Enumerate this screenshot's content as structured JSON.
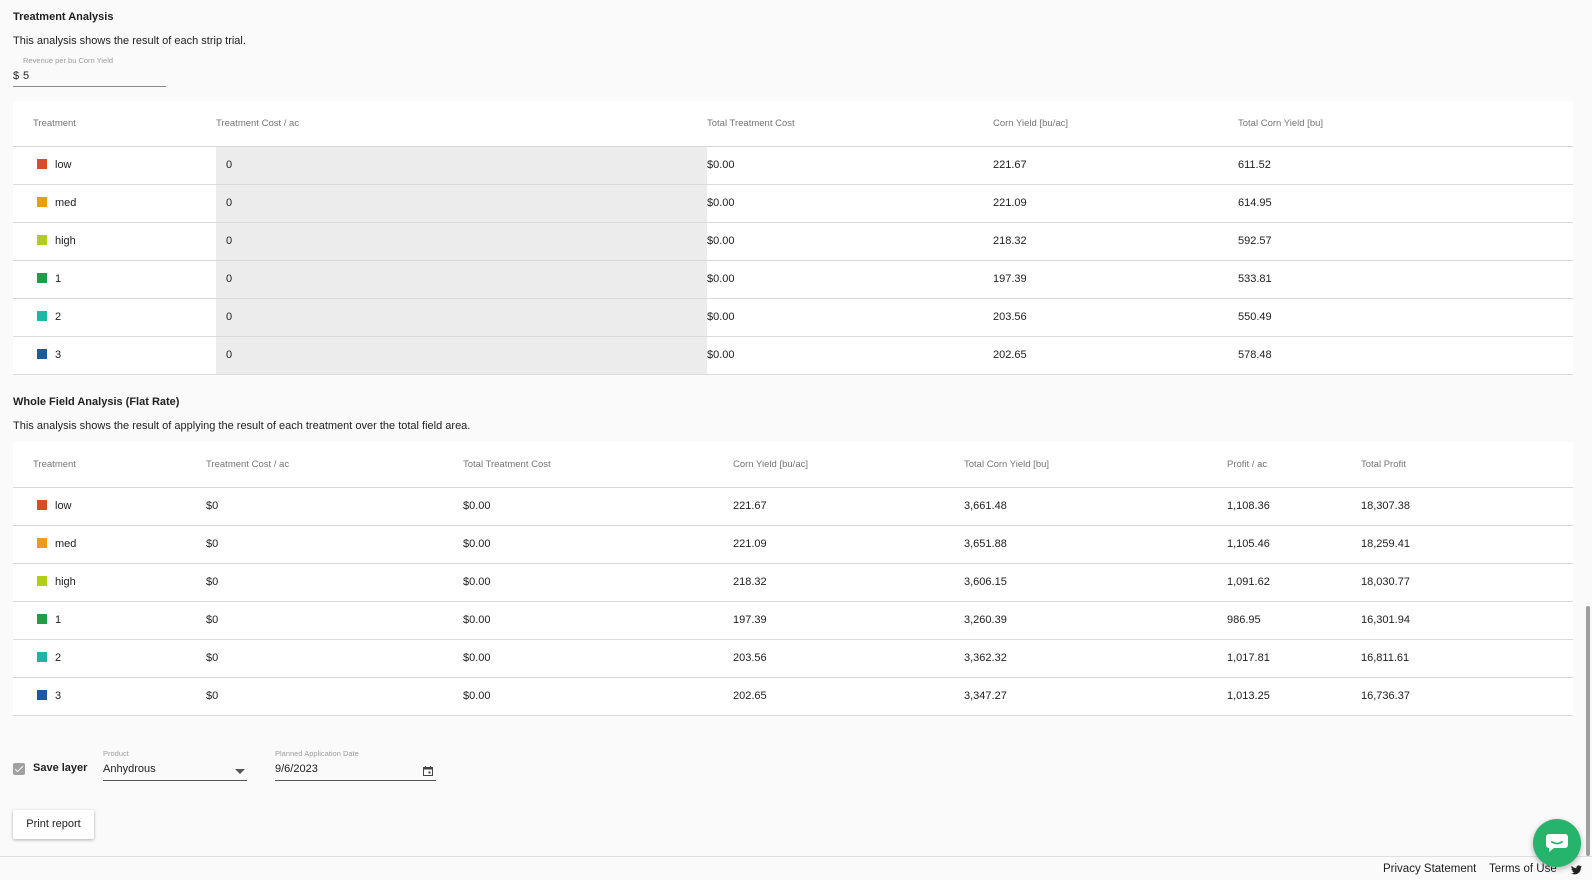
{
  "treatment_analysis": {
    "title": "Treatment Analysis",
    "description": "This analysis shows the result of each strip trial.",
    "revenue_label": "Revenue per bu Corn Yield",
    "revenue_prefix": "$",
    "revenue_value": "5",
    "headers": [
      "Treatment",
      "Treatment Cost / ac",
      "Total Treatment Cost",
      "Corn Yield [bu/ac]",
      "Total Corn Yield [bu]"
    ],
    "rows": [
      {
        "name": "low",
        "color": "#d64e27",
        "cost": "0",
        "total_cost": "$0.00",
        "yield": "221.67",
        "total_yield": "611.52"
      },
      {
        "name": "med",
        "color": "#f09a1a",
        "cost": "0",
        "total_cost": "$0.00",
        "yield": "221.09",
        "total_yield": "614.95"
      },
      {
        "name": "high",
        "color": "#b3cd1c",
        "cost": "0",
        "total_cost": "$0.00",
        "yield": "218.32",
        "total_yield": "592.57"
      },
      {
        "name": "1",
        "color": "#1e9e48",
        "cost": "0",
        "total_cost": "$0.00",
        "yield": "197.39",
        "total_yield": "533.81"
      },
      {
        "name": "2",
        "color": "#1fb5a6",
        "cost": "0",
        "total_cost": "$0.00",
        "yield": "203.56",
        "total_yield": "550.49"
      },
      {
        "name": "3",
        "color": "#1a5aa0",
        "cost": "0",
        "total_cost": "$0.00",
        "yield": "202.65",
        "total_yield": "578.48"
      }
    ]
  },
  "whole_field": {
    "title": "Whole Field Analysis (Flat Rate)",
    "description": "This analysis shows the result of applying the result of each treatment over the total field area.",
    "headers": [
      "Treatment",
      "Treatment Cost / ac",
      "Total Treatment Cost",
      "Corn Yield [bu/ac]",
      "Total Corn Yield [bu]",
      "Profit / ac",
      "Total Profit"
    ],
    "rows": [
      {
        "name": "low",
        "color": "#d64e27",
        "cost": "$0",
        "total_cost": "$0.00",
        "yield": "221.67",
        "total_yield": "3,661.48",
        "profit": "1,108.36",
        "total_profit": "18,307.38"
      },
      {
        "name": "med",
        "color": "#f09a1a",
        "cost": "$0",
        "total_cost": "$0.00",
        "yield": "221.09",
        "total_yield": "3,651.88",
        "profit": "1,105.46",
        "total_profit": "18,259.41"
      },
      {
        "name": "high",
        "color": "#b3cd1c",
        "cost": "$0",
        "total_cost": "$0.00",
        "yield": "218.32",
        "total_yield": "3,606.15",
        "profit": "1,091.62",
        "total_profit": "18,030.77"
      },
      {
        "name": "1",
        "color": "#1e9e48",
        "cost": "$0",
        "total_cost": "$0.00",
        "yield": "197.39",
        "total_yield": "3,260.39",
        "profit": "986.95",
        "total_profit": "16,301.94"
      },
      {
        "name": "2",
        "color": "#1fb5a6",
        "cost": "$0",
        "total_cost": "$0.00",
        "yield": "203.56",
        "total_yield": "3,362.32",
        "profit": "1,017.81",
        "total_profit": "16,811.61"
      },
      {
        "name": "3",
        "color": "#1a5aa0",
        "cost": "$0",
        "total_cost": "$0.00",
        "yield": "202.65",
        "total_yield": "3,347.27",
        "profit": "1,013.25",
        "total_profit": "16,736.37"
      }
    ]
  },
  "controls": {
    "save_layer_label": "Save layer",
    "save_layer_checked": true,
    "product_label": "Product",
    "product_value": "Anhydrous",
    "date_label": "Planned Application Date",
    "date_value": "9/6/2023",
    "print_label": "Print report"
  },
  "footer": {
    "privacy": "Privacy Statement",
    "terms": "Terms of Use"
  },
  "icons": {
    "dropdown": "caret-down-icon",
    "calendar": "calendar-icon",
    "chat": "chat-icon",
    "twitter": "twitter-icon"
  }
}
